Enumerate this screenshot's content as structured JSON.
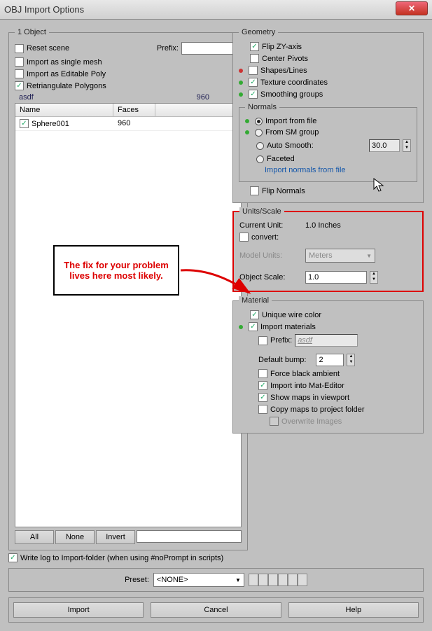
{
  "window": {
    "title": "OBJ Import Options"
  },
  "left": {
    "group_title": "1 Object",
    "reset_scene": "Reset scene",
    "prefix_label": "Prefix:",
    "prefix_value": "",
    "single_mesh": "Import as single mesh",
    "editable_poly": "Import as Editable Poly",
    "retriangulate": "Retriangulate Polygons",
    "summary_name": "asdf",
    "summary_faces": "960",
    "col_name": "Name",
    "col_faces": "Faces",
    "rows": [
      {
        "name": "Sphere001",
        "faces": "960"
      }
    ],
    "btn_all": "All",
    "btn_none": "None",
    "btn_invert": "Invert"
  },
  "geometry": {
    "title": "Geometry",
    "flip_zy": "Flip ZY-axis",
    "center_pivots": "Center Pivots",
    "shapes_lines": "Shapes/Lines",
    "tex_coords": "Texture coordinates",
    "smoothing": "Smoothing groups"
  },
  "normals": {
    "title": "Normals",
    "import_file": "Import from file",
    "from_sm": "From SM group",
    "auto_smooth": "Auto Smooth:",
    "auto_smooth_val": "30.0",
    "faceted": "Faceted",
    "link": "Import normals from file",
    "flip": "Flip Normals"
  },
  "units": {
    "title": "Units/Scale",
    "current_unit_label": "Current Unit:",
    "current_unit_value": "1.0 Inches",
    "convert": "convert:",
    "model_units_label": "Model Units:",
    "model_units_value": "Meters",
    "object_scale_label": "Object Scale:",
    "object_scale_value": "1.0"
  },
  "material": {
    "title": "Material",
    "unique_wire": "Unique wire color",
    "import_mat": "Import materials",
    "prefix_label": "Prefix:",
    "prefix_value": "asdf",
    "default_bump_label": "Default bump:",
    "default_bump_value": "2",
    "force_black": "Force black ambient",
    "import_mateditor": "Import into Mat-Editor",
    "show_maps": "Show maps in viewport",
    "copy_maps": "Copy maps to project folder",
    "overwrite": "Overwrite Images"
  },
  "footer": {
    "write_log": "Write log to Import-folder (when using #noPrompt in scripts)",
    "preset_label": "Preset:",
    "preset_value": "<NONE>",
    "import": "Import",
    "cancel": "Cancel",
    "help": "Help"
  },
  "callout": {
    "text": "The fix for your problem lives here most likely."
  }
}
